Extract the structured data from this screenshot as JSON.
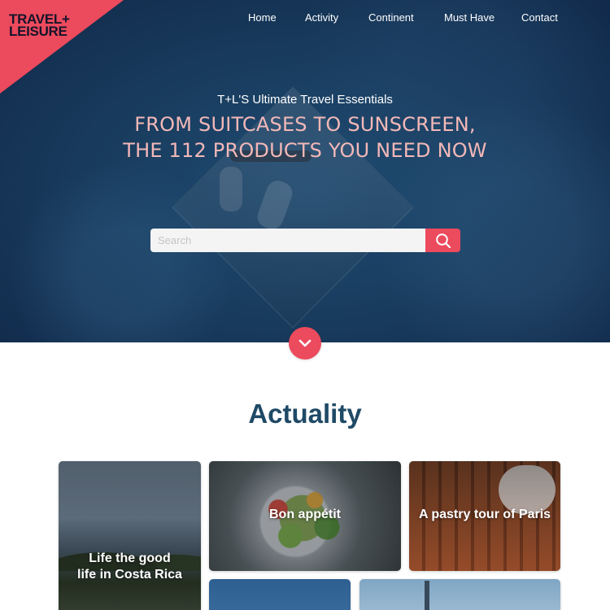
{
  "brand": {
    "line1": "TRAVEL+",
    "line2": "LEISURE",
    "accent": "#ec4a5d"
  },
  "nav": {
    "items": [
      "Home",
      "Activity",
      "Continent",
      "Must Have",
      "Contact"
    ]
  },
  "hero": {
    "subtitle": "T+L'S Ultimate Travel Essentials",
    "title_line1": "FROM SUITCASES TO SUNSCREEN,",
    "title_line2": "THE 112 PRODUCTS YOU NEED NOW"
  },
  "search": {
    "placeholder": "Search",
    "value": "",
    "icon": "search-icon"
  },
  "scroll": {
    "icon": "chevron-down-icon"
  },
  "section": {
    "title": "Actuality"
  },
  "cards": [
    {
      "label_line1": "Life the good",
      "label_line2": "life in Costa Rica"
    },
    {
      "label": "Bon appétit"
    },
    {
      "label": "A pastry tour of Paris"
    }
  ],
  "colors": {
    "accent": "#ec4a5d",
    "heading": "#1f4a66",
    "hero_title": "#f3b8b8"
  }
}
